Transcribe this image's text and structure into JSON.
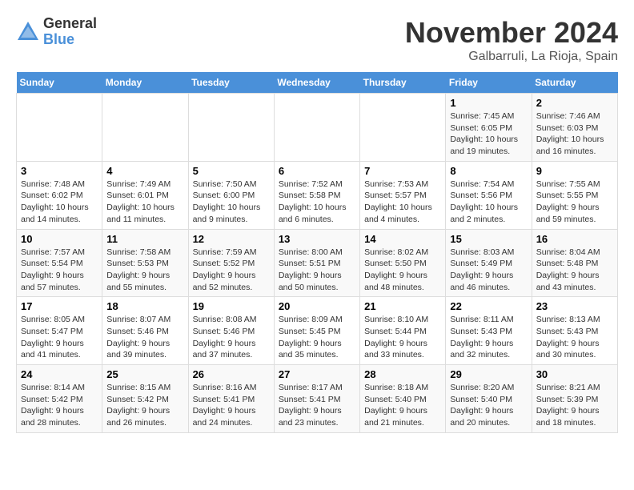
{
  "logo": {
    "general": "General",
    "blue": "Blue"
  },
  "title": "November 2024",
  "location": "Galbarruli, La Rioja, Spain",
  "weekdays": [
    "Sunday",
    "Monday",
    "Tuesday",
    "Wednesday",
    "Thursday",
    "Friday",
    "Saturday"
  ],
  "weeks": [
    [
      {
        "day": "",
        "info": ""
      },
      {
        "day": "",
        "info": ""
      },
      {
        "day": "",
        "info": ""
      },
      {
        "day": "",
        "info": ""
      },
      {
        "day": "",
        "info": ""
      },
      {
        "day": "1",
        "info": "Sunrise: 7:45 AM\nSunset: 6:05 PM\nDaylight: 10 hours\nand 19 minutes."
      },
      {
        "day": "2",
        "info": "Sunrise: 7:46 AM\nSunset: 6:03 PM\nDaylight: 10 hours\nand 16 minutes."
      }
    ],
    [
      {
        "day": "3",
        "info": "Sunrise: 7:48 AM\nSunset: 6:02 PM\nDaylight: 10 hours\nand 14 minutes."
      },
      {
        "day": "4",
        "info": "Sunrise: 7:49 AM\nSunset: 6:01 PM\nDaylight: 10 hours\nand 11 minutes."
      },
      {
        "day": "5",
        "info": "Sunrise: 7:50 AM\nSunset: 6:00 PM\nDaylight: 10 hours\nand 9 minutes."
      },
      {
        "day": "6",
        "info": "Sunrise: 7:52 AM\nSunset: 5:58 PM\nDaylight: 10 hours\nand 6 minutes."
      },
      {
        "day": "7",
        "info": "Sunrise: 7:53 AM\nSunset: 5:57 PM\nDaylight: 10 hours\nand 4 minutes."
      },
      {
        "day": "8",
        "info": "Sunrise: 7:54 AM\nSunset: 5:56 PM\nDaylight: 10 hours\nand 2 minutes."
      },
      {
        "day": "9",
        "info": "Sunrise: 7:55 AM\nSunset: 5:55 PM\nDaylight: 9 hours\nand 59 minutes."
      }
    ],
    [
      {
        "day": "10",
        "info": "Sunrise: 7:57 AM\nSunset: 5:54 PM\nDaylight: 9 hours\nand 57 minutes."
      },
      {
        "day": "11",
        "info": "Sunrise: 7:58 AM\nSunset: 5:53 PM\nDaylight: 9 hours\nand 55 minutes."
      },
      {
        "day": "12",
        "info": "Sunrise: 7:59 AM\nSunset: 5:52 PM\nDaylight: 9 hours\nand 52 minutes."
      },
      {
        "day": "13",
        "info": "Sunrise: 8:00 AM\nSunset: 5:51 PM\nDaylight: 9 hours\nand 50 minutes."
      },
      {
        "day": "14",
        "info": "Sunrise: 8:02 AM\nSunset: 5:50 PM\nDaylight: 9 hours\nand 48 minutes."
      },
      {
        "day": "15",
        "info": "Sunrise: 8:03 AM\nSunset: 5:49 PM\nDaylight: 9 hours\nand 46 minutes."
      },
      {
        "day": "16",
        "info": "Sunrise: 8:04 AM\nSunset: 5:48 PM\nDaylight: 9 hours\nand 43 minutes."
      }
    ],
    [
      {
        "day": "17",
        "info": "Sunrise: 8:05 AM\nSunset: 5:47 PM\nDaylight: 9 hours\nand 41 minutes."
      },
      {
        "day": "18",
        "info": "Sunrise: 8:07 AM\nSunset: 5:46 PM\nDaylight: 9 hours\nand 39 minutes."
      },
      {
        "day": "19",
        "info": "Sunrise: 8:08 AM\nSunset: 5:46 PM\nDaylight: 9 hours\nand 37 minutes."
      },
      {
        "day": "20",
        "info": "Sunrise: 8:09 AM\nSunset: 5:45 PM\nDaylight: 9 hours\nand 35 minutes."
      },
      {
        "day": "21",
        "info": "Sunrise: 8:10 AM\nSunset: 5:44 PM\nDaylight: 9 hours\nand 33 minutes."
      },
      {
        "day": "22",
        "info": "Sunrise: 8:11 AM\nSunset: 5:43 PM\nDaylight: 9 hours\nand 32 minutes."
      },
      {
        "day": "23",
        "info": "Sunrise: 8:13 AM\nSunset: 5:43 PM\nDaylight: 9 hours\nand 30 minutes."
      }
    ],
    [
      {
        "day": "24",
        "info": "Sunrise: 8:14 AM\nSunset: 5:42 PM\nDaylight: 9 hours\nand 28 minutes."
      },
      {
        "day": "25",
        "info": "Sunrise: 8:15 AM\nSunset: 5:42 PM\nDaylight: 9 hours\nand 26 minutes."
      },
      {
        "day": "26",
        "info": "Sunrise: 8:16 AM\nSunset: 5:41 PM\nDaylight: 9 hours\nand 24 minutes."
      },
      {
        "day": "27",
        "info": "Sunrise: 8:17 AM\nSunset: 5:41 PM\nDaylight: 9 hours\nand 23 minutes."
      },
      {
        "day": "28",
        "info": "Sunrise: 8:18 AM\nSunset: 5:40 PM\nDaylight: 9 hours\nand 21 minutes."
      },
      {
        "day": "29",
        "info": "Sunrise: 8:20 AM\nSunset: 5:40 PM\nDaylight: 9 hours\nand 20 minutes."
      },
      {
        "day": "30",
        "info": "Sunrise: 8:21 AM\nSunset: 5:39 PM\nDaylight: 9 hours\nand 18 minutes."
      }
    ]
  ]
}
